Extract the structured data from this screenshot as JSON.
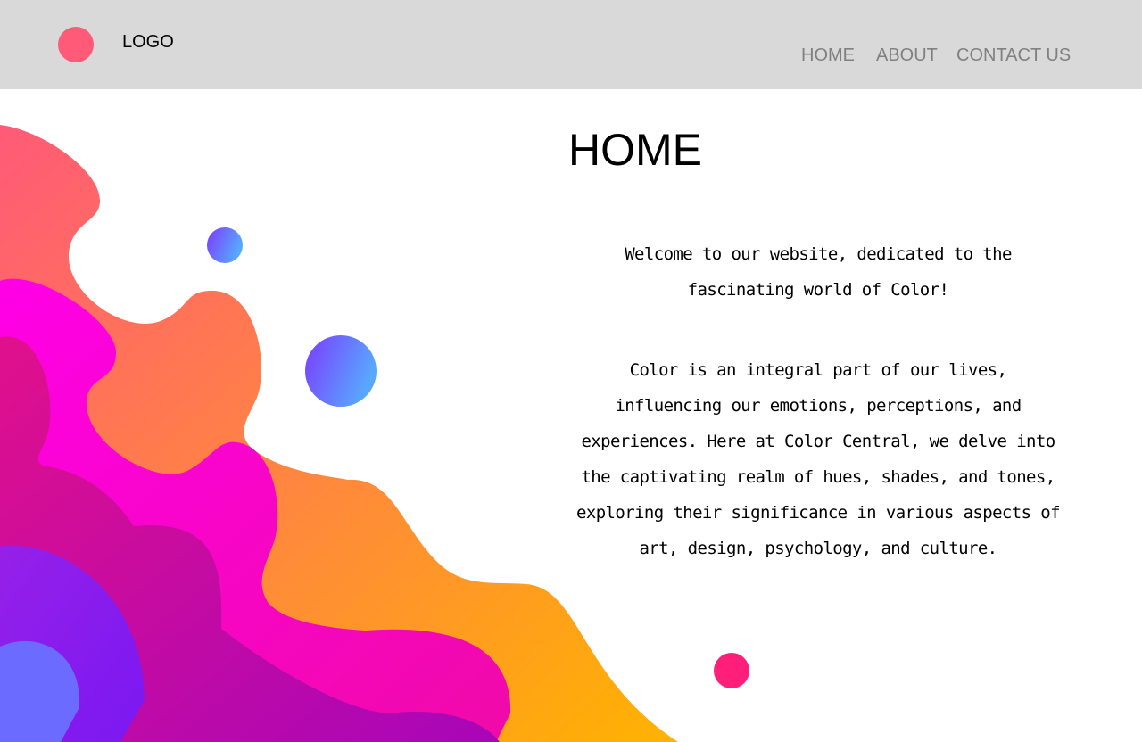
{
  "header": {
    "logo_text": "LOGO",
    "nav": {
      "home": "HOME",
      "about": "ABOUT",
      "contact": "CONTACT US"
    }
  },
  "main": {
    "title": "HOME",
    "welcome_line1": "Welcome to our website, dedicated to the",
    "welcome_line2": "fascinating world of Color!",
    "body_lines": [
      "Color is an integral part of our lives,",
      "influencing our emotions, perceptions, and",
      "experiences. Here at Color Central, we delve into",
      "the captivating realm of hues, shades, and tones,",
      "exploring their significance in various aspects of",
      "art, design, psychology, and culture."
    ]
  },
  "colors": {
    "header_bg": "#d9d9d9",
    "logo_dot": "#ff5a78",
    "nav_text": "#808080",
    "accent_pink": "#ff1f7a",
    "blob_orange_start": "#ff5a78",
    "blob_orange_end": "#ffb300",
    "blob_magenta": "#ff00d0",
    "blob_violet": "#8a1cf0",
    "circle_gradient_start": "#7b3bff",
    "circle_gradient_end": "#58a8ff"
  }
}
